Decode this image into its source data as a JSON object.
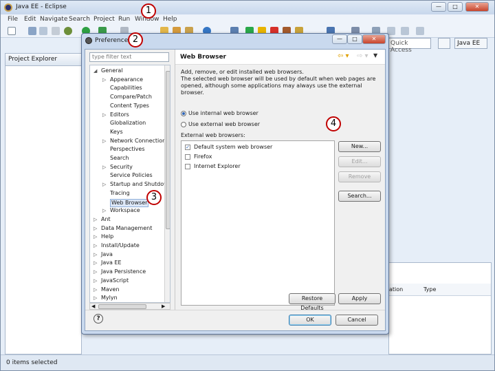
{
  "window": {
    "title": "Java EE - Eclipse",
    "menus": [
      "File",
      "Edit",
      "Navigate",
      "Search",
      "Project",
      "Run",
      "Window",
      "Help"
    ],
    "quick_access": "Quick Access",
    "perspective": "Java EE"
  },
  "project_explorer": {
    "tab_label": "Project Explorer"
  },
  "background_table": {
    "col1": "ation",
    "col2": "Type"
  },
  "status_bar": {
    "text": "0 items selected"
  },
  "preferences": {
    "title": "Preferences",
    "filter_placeholder": "type filter text",
    "tree": [
      {
        "label": "General",
        "level": 0,
        "twisty": "open"
      },
      {
        "label": "Appearance",
        "level": 1,
        "twisty": "closed"
      },
      {
        "label": "Capabilities",
        "level": 1,
        "twisty": ""
      },
      {
        "label": "Compare/Patch",
        "level": 1,
        "twisty": ""
      },
      {
        "label": "Content Types",
        "level": 1,
        "twisty": ""
      },
      {
        "label": "Editors",
        "level": 1,
        "twisty": "closed"
      },
      {
        "label": "Globalization",
        "level": 1,
        "twisty": ""
      },
      {
        "label": "Keys",
        "level": 1,
        "twisty": ""
      },
      {
        "label": "Network Connection",
        "level": 1,
        "twisty": "closed"
      },
      {
        "label": "Perspectives",
        "level": 1,
        "twisty": ""
      },
      {
        "label": "Search",
        "level": 1,
        "twisty": ""
      },
      {
        "label": "Security",
        "level": 1,
        "twisty": "closed"
      },
      {
        "label": "Service Policies",
        "level": 1,
        "twisty": ""
      },
      {
        "label": "Startup and Shutdown",
        "level": 1,
        "twisty": "closed"
      },
      {
        "label": "Tracing",
        "level": 1,
        "twisty": ""
      },
      {
        "label": "Web Browser",
        "level": 1,
        "twisty": "",
        "selected": true
      },
      {
        "label": "Workspace",
        "level": 1,
        "twisty": "closed"
      },
      {
        "label": "Ant",
        "level": 0,
        "twisty": "closed"
      },
      {
        "label": "Data Management",
        "level": 0,
        "twisty": "closed"
      },
      {
        "label": "Help",
        "level": 0,
        "twisty": "closed"
      },
      {
        "label": "Install/Update",
        "level": 0,
        "twisty": "closed"
      },
      {
        "label": "Java",
        "level": 0,
        "twisty": "closed"
      },
      {
        "label": "Java EE",
        "level": 0,
        "twisty": "closed"
      },
      {
        "label": "Java Persistence",
        "level": 0,
        "twisty": "closed"
      },
      {
        "label": "JavaScript",
        "level": 0,
        "twisty": "closed"
      },
      {
        "label": "Maven",
        "level": 0,
        "twisty": "closed"
      },
      {
        "label": "Mylyn",
        "level": 0,
        "twisty": "closed"
      }
    ],
    "page": {
      "title": "Web Browser",
      "desc_line1": "Add, remove, or edit installed web browsers.",
      "desc_line2": "The selected web browser will be used by default when web pages are",
      "desc_line3": "opened, although some applications may always use the external browser.",
      "radio_internal": "Use internal web browser",
      "radio_external": "Use external web browser",
      "list_label": "External web browsers:",
      "browsers": [
        {
          "name": "Default system web browser",
          "checked": true
        },
        {
          "name": "Firefox",
          "checked": false
        },
        {
          "name": "Internet Explorer",
          "checked": false
        }
      ],
      "btn_new": "New...",
      "btn_edit": "Edit...",
      "btn_remove": "Remove",
      "btn_search": "Search...",
      "btn_restore": "Restore Defaults",
      "btn_apply": "Apply"
    },
    "btn_ok": "OK",
    "btn_cancel": "Cancel"
  },
  "callouts": [
    "1",
    "2",
    "3",
    "4"
  ]
}
